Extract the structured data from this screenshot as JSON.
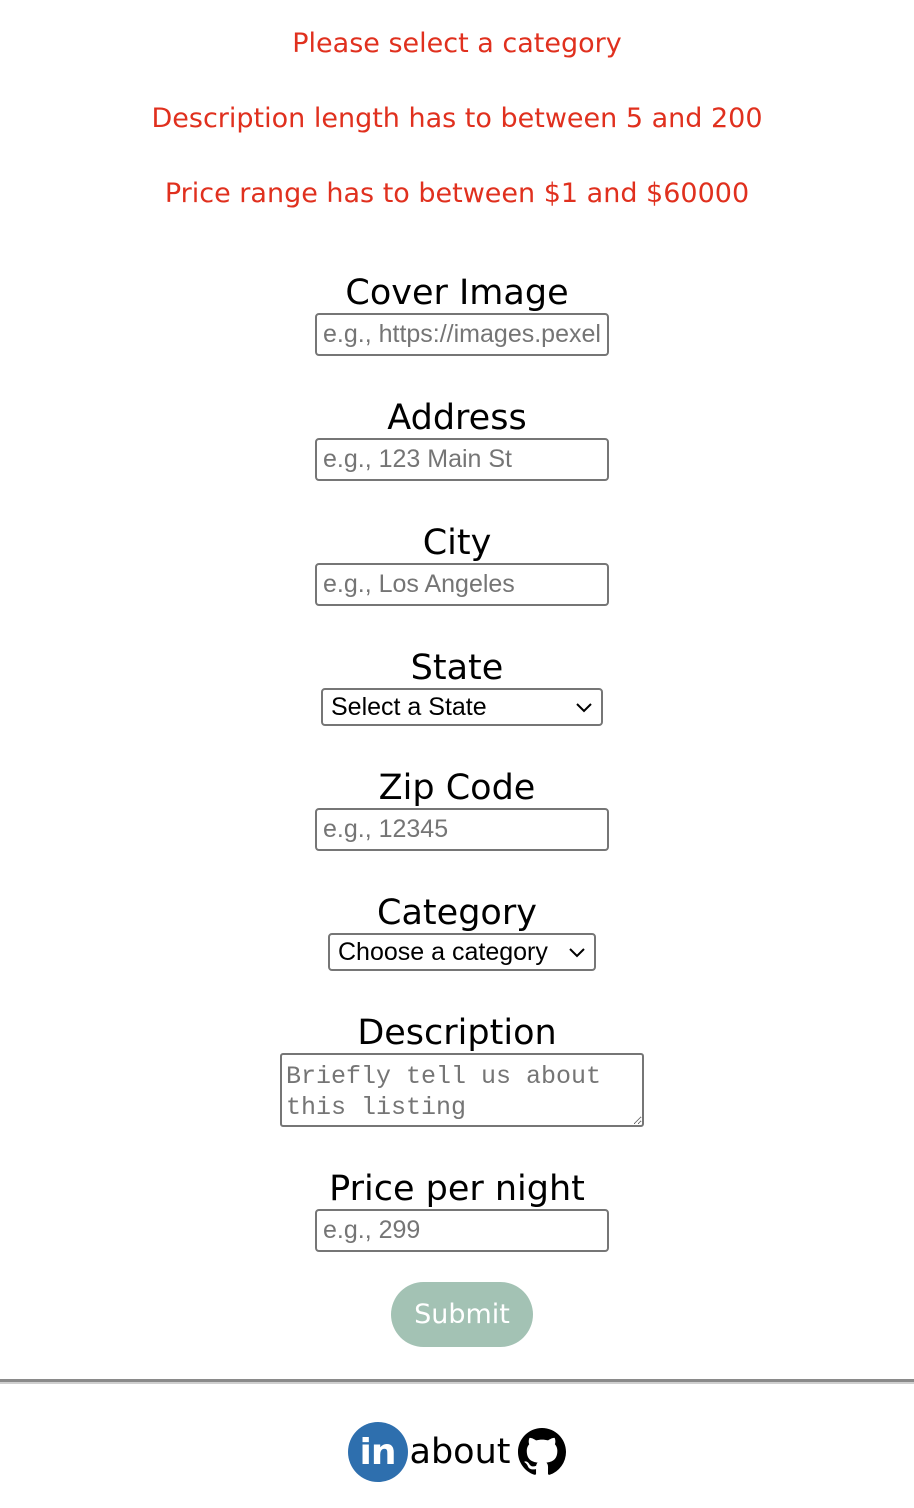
{
  "errors": {
    "category": "Please select a category",
    "description": "Description length has to between 5 and 200",
    "price": "Price range has to between $1 and $60000"
  },
  "form": {
    "cover_image": {
      "label": "Cover Image",
      "placeholder": "e.g., https://images.pexels.com/photos/"
    },
    "address": {
      "label": "Address",
      "placeholder": "e.g., 123 Main St"
    },
    "city": {
      "label": "City",
      "placeholder": "e.g., Los Angeles"
    },
    "state": {
      "label": "State",
      "selected": "Select a State"
    },
    "zip": {
      "label": "Zip Code",
      "placeholder": "e.g., 12345"
    },
    "category": {
      "label": "Category",
      "selected": "Choose a category"
    },
    "description": {
      "label": "Description",
      "placeholder": "Briefly tell us about this listing"
    },
    "price": {
      "label": "Price per night",
      "placeholder": "e.g., 299"
    },
    "submit_label": "Submit"
  },
  "footer": {
    "linkedin_text": "in",
    "about_label": "about",
    "icons": [
      "linkedin-icon",
      "github-icon"
    ]
  },
  "colors": {
    "error": "#e0301e",
    "submit_bg": "#a3c2b4",
    "linkedin_bg": "#2e6fae"
  }
}
